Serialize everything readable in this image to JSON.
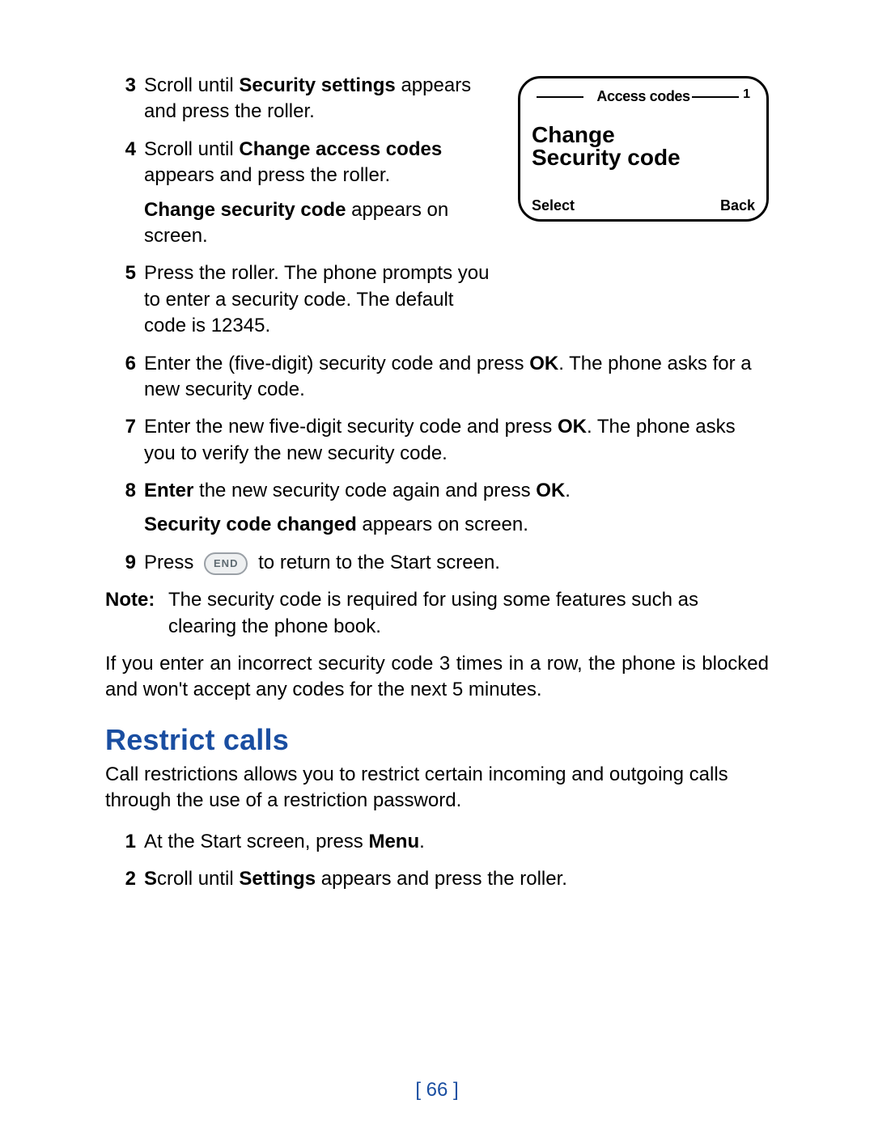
{
  "phone": {
    "titlebar": "Access codes",
    "index": "1",
    "main_line1": "Change",
    "main_line2": "Security code",
    "softkey_left": "Select",
    "softkey_right": "Back"
  },
  "stepsA": [
    {
      "num": "3",
      "parts": [
        {
          "t": "Scroll until "
        },
        {
          "t": "Security settings",
          "b": true
        },
        {
          "t": " appears and press the roller."
        }
      ]
    },
    {
      "num": "4",
      "parts": [
        {
          "t": "Scroll until "
        },
        {
          "t": "Change access codes",
          "b": true
        },
        {
          "t": " appears and press the roller."
        }
      ],
      "after": [
        {
          "t": "Change security code",
          "b": true
        },
        {
          "t": " appears on screen."
        }
      ]
    },
    {
      "num": "5",
      "parts": [
        {
          "t": "Press the roller. The phone prompts you to enter a security code. The default code is 12345."
        }
      ]
    }
  ],
  "stepsB": [
    {
      "num": "6",
      "parts": [
        {
          "t": "Enter the (five-digit) security code and press "
        },
        {
          "t": "OK",
          "b": true
        },
        {
          "t": ". The phone asks for a new security code."
        }
      ]
    },
    {
      "num": "7",
      "parts": [
        {
          "t": "Enter the new five-digit security code and press "
        },
        {
          "t": "OK",
          "b": true
        },
        {
          "t": ". The phone asks you to verify the new security code."
        }
      ]
    },
    {
      "num": "8",
      "parts": [
        {
          "t": "Enter",
          "b": true
        },
        {
          "t": " the new security code again and press "
        },
        {
          "t": "OK",
          "b": true
        },
        {
          "t": "."
        }
      ],
      "after": [
        {
          "t": "Security code changed",
          "b": true
        },
        {
          "t": " appears on screen."
        }
      ]
    },
    {
      "num": "9",
      "parts": [
        {
          "t": "Press "
        },
        {
          "chip": "END"
        },
        {
          "t": " to return to the Start screen."
        }
      ]
    }
  ],
  "note": {
    "label": "Note:",
    "text": "The security code is required for using some features such as clearing the phone book."
  },
  "blocked_para": "If you enter an incorrect security code 3 times in a row, the phone is blocked and won't accept any codes for the next 5 minutes.",
  "section_heading": "Restrict calls",
  "restrict_intro": "Call restrictions allows you to restrict certain incoming and outgoing calls through the use of a restriction password.",
  "stepsC": [
    {
      "num": "1",
      "parts": [
        {
          "t": "At the Start screen, press "
        },
        {
          "t": "Menu",
          "b": true
        },
        {
          "t": "."
        }
      ]
    },
    {
      "num": "2",
      "parts": [
        {
          "t": "S",
          "b": true
        },
        {
          "t": "croll until "
        },
        {
          "t": "Settings",
          "b": true
        },
        {
          "t": " appears and press the roller."
        }
      ]
    }
  ],
  "page_number": "[ 66 ]"
}
